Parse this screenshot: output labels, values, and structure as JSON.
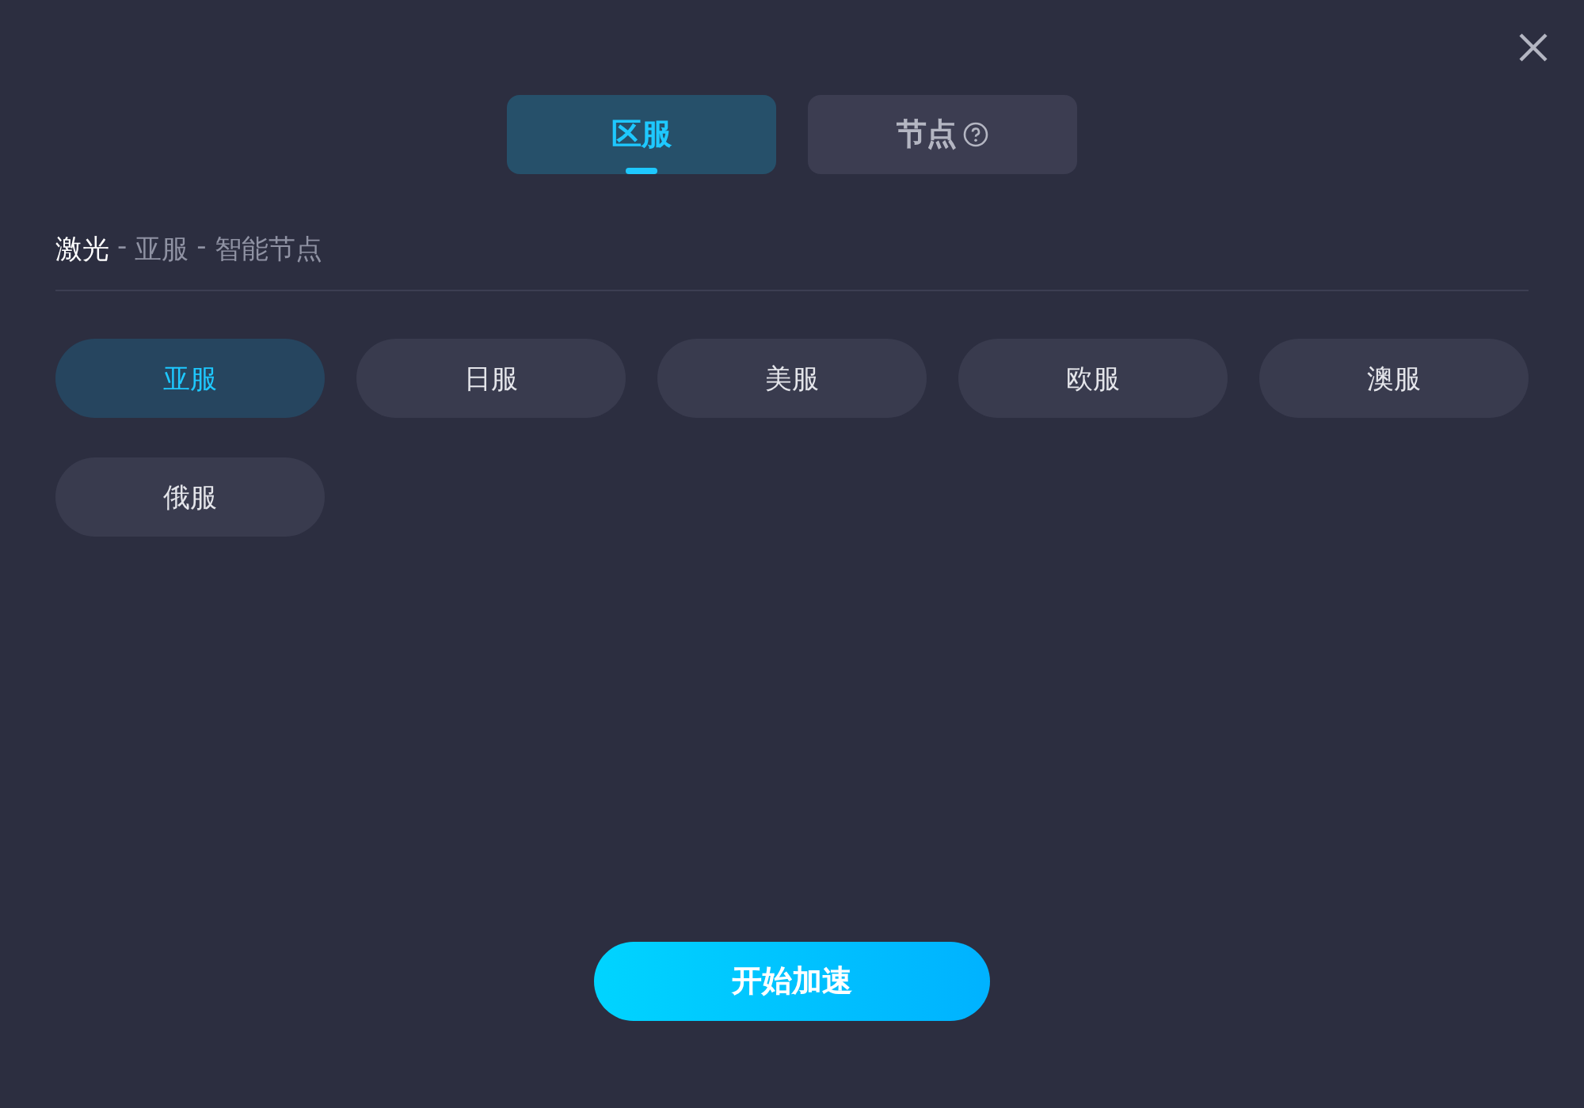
{
  "tabs": [
    {
      "label": "区服",
      "selected": true,
      "help": false
    },
    {
      "label": "节点",
      "selected": false,
      "help": true
    }
  ],
  "breadcrumb": [
    "激光",
    "-",
    "亚服",
    "-",
    "智能节点"
  ],
  "regions": [
    {
      "label": "亚服",
      "selected": true
    },
    {
      "label": "日服",
      "selected": false
    },
    {
      "label": "美服",
      "selected": false
    },
    {
      "label": "欧服",
      "selected": false
    },
    {
      "label": "澳服",
      "selected": false
    },
    {
      "label": "俄服",
      "selected": false
    }
  ],
  "start_button": "开始加速"
}
